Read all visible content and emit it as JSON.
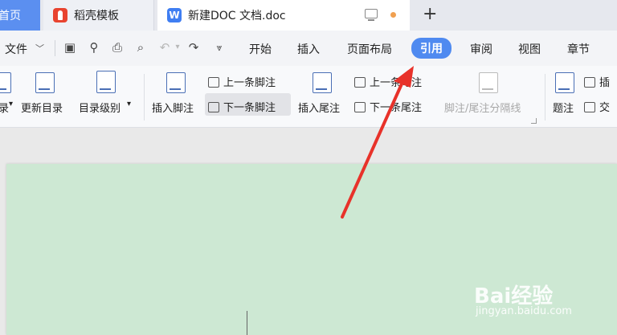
{
  "tabs": {
    "home": "首页",
    "docer": "稻壳模板",
    "doc": "新建DOC 文档.doc",
    "new_tab": "+"
  },
  "menu": {
    "file": "文件",
    "tabs": [
      "开始",
      "插入",
      "页面布局",
      "引用",
      "审阅",
      "视图",
      "章节"
    ],
    "active_tab": "引用"
  },
  "ribbon": {
    "toc_partial": "录",
    "update_toc": "更新目录",
    "toc_level": "目录级别",
    "insert_footnote": "插入脚注",
    "prev_footnote": "上一条脚注",
    "next_footnote": "下一条脚注",
    "insert_endnote": "插入尾注",
    "prev_endnote": "上一条尾注",
    "next_endnote": "下一条尾注",
    "separator": "脚注/尾注分隔线",
    "caption": "题注",
    "insert_partial": "插",
    "cross_partial": "交"
  },
  "colors": {
    "accent": "#4f8af0",
    "page_bg": "#cde8d3",
    "arrow": "#e8322a"
  },
  "watermark": {
    "logo": "Bai经验",
    "url": "jingyan.baidu.com"
  }
}
